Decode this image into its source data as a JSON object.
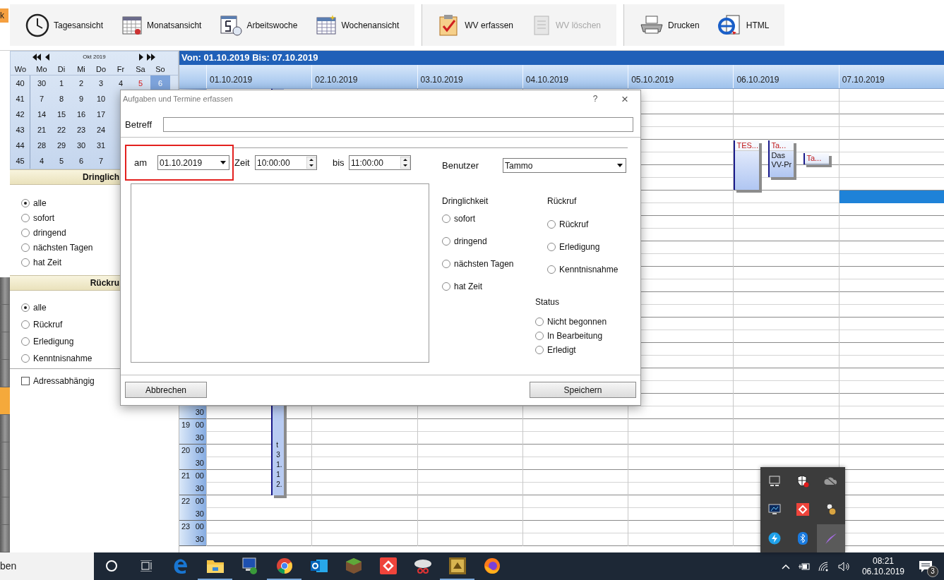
{
  "edge_tab": {
    "label": "k"
  },
  "toolbar": {
    "groups": [
      {
        "buttons": [
          {
            "label": "Tagesansicht",
            "disabled": false
          },
          {
            "label": "Monatsansicht",
            "disabled": false
          },
          {
            "label": "Arbeitswoche",
            "disabled": false
          },
          {
            "label": "Wochenansicht",
            "disabled": false
          }
        ]
      },
      {
        "buttons": [
          {
            "label": "WV erfassen",
            "disabled": false
          },
          {
            "label": "WV löschen",
            "disabled": true
          }
        ]
      },
      {
        "buttons": [
          {
            "label": "Drucken",
            "disabled": false
          },
          {
            "label": "HTML",
            "disabled": false
          }
        ]
      }
    ]
  },
  "side_tabs": [
    {
      "selected": false
    },
    {
      "selected": false
    },
    {
      "selected": false
    },
    {
      "selected": false
    },
    {
      "selected": true
    },
    {
      "selected": false
    },
    {
      "selected": false
    },
    {
      "selected": false
    },
    {
      "selected": false
    },
    {
      "selected": false
    }
  ],
  "mini_calendar": {
    "month": "Okt 2019",
    "headers": [
      "Wo",
      "Mo",
      "Di",
      "Mi",
      "Do",
      "Fr",
      "Sa",
      "So"
    ],
    "weeks": [
      {
        "week": "40",
        "days": [
          {
            "label": "30",
            "kind": "day",
            "selected": false
          },
          {
            "label": "1",
            "kind": "day",
            "selected": false
          },
          {
            "label": "2",
            "kind": "day",
            "selected": false
          },
          {
            "label": "3",
            "kind": "day",
            "selected": false
          },
          {
            "label": "4",
            "kind": "day",
            "selected": false
          },
          {
            "label": "5",
            "kind": "holiday",
            "selected": false
          },
          {
            "label": "6",
            "kind": "day",
            "selected": true
          }
        ]
      },
      {
        "week": "41",
        "days": [
          {
            "label": "7",
            "kind": "day",
            "selected": false
          },
          {
            "label": "8",
            "kind": "day",
            "selected": false
          },
          {
            "label": "9",
            "kind": "day",
            "selected": false
          },
          {
            "label": "10",
            "kind": "day",
            "selected": false
          }
        ]
      },
      {
        "week": "42",
        "days": [
          {
            "label": "14",
            "kind": "day",
            "selected": false
          },
          {
            "label": "15",
            "kind": "day",
            "selected": false
          },
          {
            "label": "16",
            "kind": "day",
            "selected": false
          },
          {
            "label": "17",
            "kind": "day",
            "selected": false
          }
        ]
      },
      {
        "week": "43",
        "days": [
          {
            "label": "21",
            "kind": "day",
            "selected": false
          },
          {
            "label": "22",
            "kind": "day",
            "selected": false
          },
          {
            "label": "23",
            "kind": "day",
            "selected": false
          },
          {
            "label": "24",
            "kind": "day",
            "selected": false
          }
        ]
      },
      {
        "week": "44",
        "days": [
          {
            "label": "28",
            "kind": "day",
            "selected": false
          },
          {
            "label": "29",
            "kind": "day",
            "selected": false
          },
          {
            "label": "30",
            "kind": "day",
            "selected": false
          },
          {
            "label": "31",
            "kind": "day",
            "selected": false
          }
        ]
      },
      {
        "week": "45",
        "days": [
          {
            "label": "4",
            "kind": "day",
            "selected": false
          },
          {
            "label": "5",
            "kind": "day",
            "selected": false
          },
          {
            "label": "6",
            "kind": "day",
            "selected": false
          },
          {
            "label": "7",
            "kind": "day",
            "selected": false
          }
        ]
      }
    ]
  },
  "filters": [
    {
      "title": "Dringlich",
      "options": [
        {
          "label": "alle",
          "selected": true
        },
        {
          "label": "sofort",
          "selected": false
        },
        {
          "label": "dringend",
          "selected": false
        },
        {
          "label": "nächsten Tagen",
          "selected": false
        },
        {
          "label": "hat Zeit",
          "selected": false
        }
      ]
    },
    {
      "title": "Rückru",
      "options": [
        {
          "label": "alle",
          "selected": true
        },
        {
          "label": "Rückruf",
          "selected": false
        },
        {
          "label": "Erledigung",
          "selected": false
        },
        {
          "label": "Kenntnisnahme",
          "selected": false
        }
      ]
    }
  ],
  "address_filter": {
    "label": "Adressabhängig",
    "checked": false
  },
  "calendar": {
    "range": "Von: 01.10.2019 Bis: 07.10.2019",
    "days": [
      "01.10.2019",
      "02.10.2019",
      "03.10.2019",
      "04.10.2019",
      "05.10.2019",
      "06.10.2019",
      "07.10.2019"
    ],
    "time_labels": [
      {
        "minute": "30"
      },
      {
        "hour": "19",
        "minute": "00"
      },
      {
        "minute": "30"
      },
      {
        "hour": "20",
        "minute": "00"
      },
      {
        "minute": "30"
      },
      {
        "hour": "21",
        "minute": "00"
      },
      {
        "minute": "30"
      },
      {
        "hour": "22",
        "minute": "00"
      },
      {
        "minute": "30"
      },
      {
        "hour": "23",
        "minute": "00"
      },
      {
        "minute": "30"
      }
    ],
    "appointments": [
      {
        "kind": "vertical",
        "text": "t31.12."
      },
      {
        "kind": "block",
        "title": "TES..."
      },
      {
        "kind": "block",
        "title": "Ta...",
        "body": "Das VV-Pr"
      },
      {
        "kind": "block",
        "title": "Ta..."
      },
      {
        "kind": "bar"
      }
    ]
  },
  "dialog": {
    "title": "Aufgaben und Termine erfassen",
    "help": "?",
    "close": "×",
    "subject": {
      "label": "Betreff"
    },
    "date": {
      "label": "am",
      "value": "01.10.2019",
      "highlighted": true
    },
    "time_from": {
      "label": "Zeit",
      "value": "10:00:00"
    },
    "time_to": {
      "label": "bis",
      "value": "11:00:00"
    },
    "user": {
      "label": "Benutzer",
      "value": "Tammo"
    },
    "urgency": {
      "title": "Dringlichkeit",
      "options": [
        {
          "label": "sofort",
          "selected": false
        },
        {
          "label": "dringend",
          "selected": false
        },
        {
          "label": "nächsten Tagen",
          "selected": false
        },
        {
          "label": "hat Zeit",
          "selected": false
        }
      ]
    },
    "callback": {
      "title": "Rückruf",
      "options": [
        {
          "label": "Rückruf",
          "selected": false
        },
        {
          "label": "Erledigung",
          "selected": false
        },
        {
          "label": "Kenntnisnahme",
          "selected": false
        }
      ]
    },
    "status": {
      "title": "Status",
      "options": [
        {
          "label": "Nicht begonnen",
          "selected": false
        },
        {
          "label": "In Bearbeitung",
          "selected": false
        },
        {
          "label": "Erledigt",
          "selected": false
        }
      ]
    },
    "cancel": "Abbrechen",
    "save": "Speichern"
  },
  "tray_popup": {
    "icons": [
      {
        "kind": "display",
        "selected": false
      },
      {
        "kind": "shield",
        "selected": false
      },
      {
        "kind": "cloud",
        "selected": false
      },
      {
        "kind": "monitor",
        "selected": false
      },
      {
        "kind": "remote",
        "selected": false
      },
      {
        "kind": "mascot",
        "selected": false
      },
      {
        "kind": "bolt",
        "selected": false
      },
      {
        "kind": "bluetooth",
        "selected": false
      },
      {
        "kind": "feather",
        "selected": true
      }
    ]
  },
  "taskbar": {
    "search_text": "ben",
    "apps": [
      {
        "kind": "search-circle",
        "running": false
      },
      {
        "kind": "task-view",
        "running": false
      },
      {
        "kind": "edge",
        "running": false
      },
      {
        "kind": "folder",
        "running": true
      },
      {
        "kind": "network",
        "running": false
      },
      {
        "kind": "chrome",
        "running": true
      },
      {
        "kind": "outlook",
        "running": false
      },
      {
        "kind": "cube",
        "running": false
      },
      {
        "kind": "remote",
        "running": false
      },
      {
        "kind": "snip",
        "running": false
      },
      {
        "kind": "gold",
        "running": true
      },
      {
        "kind": "firefox",
        "running": false
      }
    ],
    "time": "08:21",
    "date": "06.10.2019",
    "notifications": "3"
  }
}
